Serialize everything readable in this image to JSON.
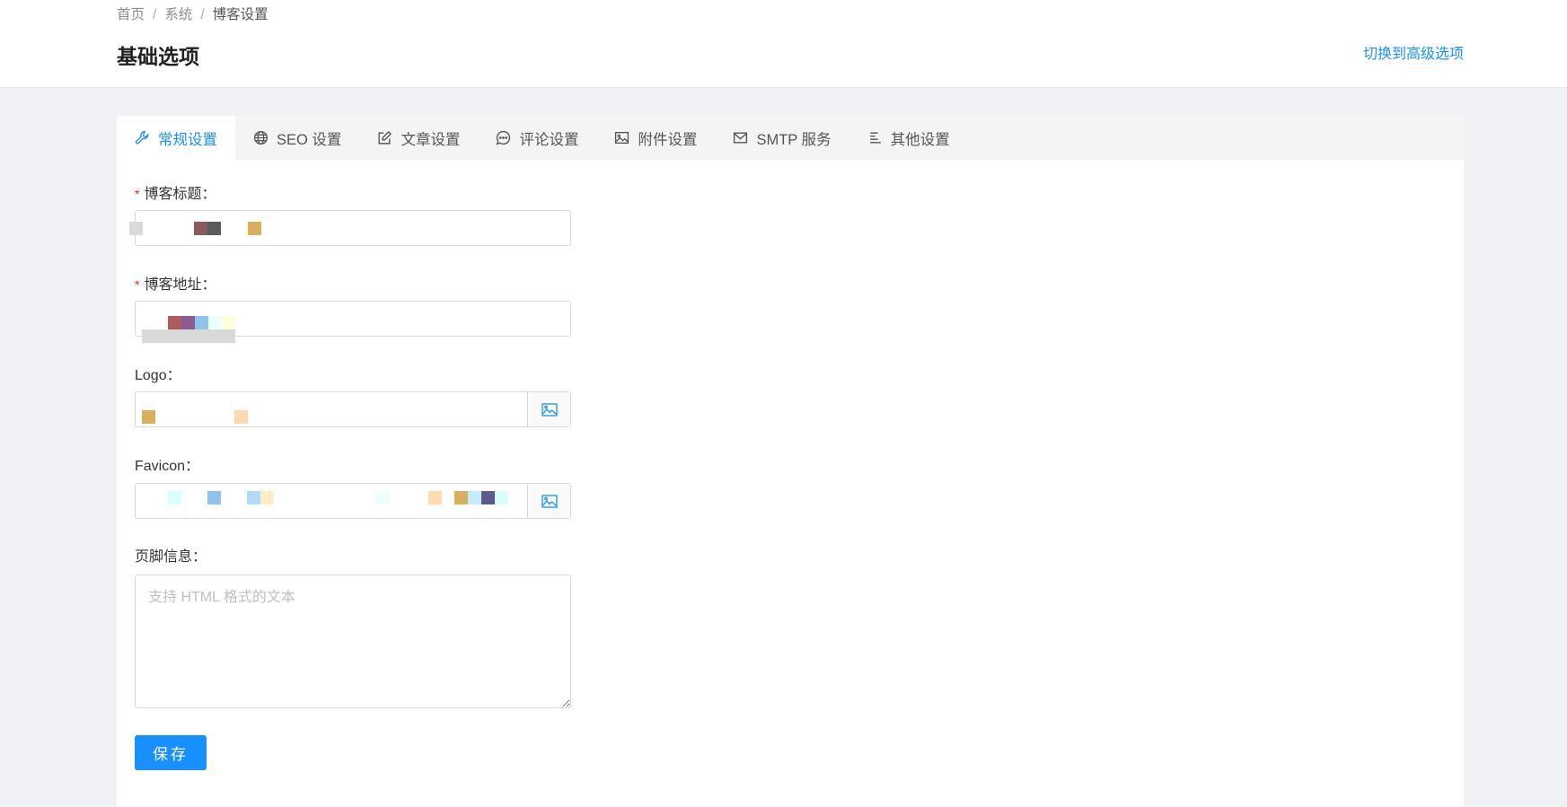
{
  "breadcrumb": [
    "首页",
    "系统",
    "博客设置"
  ],
  "breadcrumb_sep": "/",
  "page_title": "基础选项",
  "switch_link": "切换到高级选项",
  "tabs": [
    {
      "label": "常规设置",
      "icon": "wrench-icon",
      "active": true
    },
    {
      "label": "SEO 设置",
      "icon": "globe-icon"
    },
    {
      "label": "文章设置",
      "icon": "edit-icon"
    },
    {
      "label": "评论设置",
      "icon": "comment-icon"
    },
    {
      "label": "附件设置",
      "icon": "image-icon"
    },
    {
      "label": "SMTP 服务",
      "icon": "mail-icon"
    },
    {
      "label": "其他设置",
      "icon": "align-left-icon"
    }
  ],
  "form": {
    "title_label": "博客标题：",
    "url_label": "博客地址：",
    "logo_label": "Logo：",
    "favicon_label": "Favicon：",
    "footer_label": "页脚信息：",
    "footer_placeholder": "支持 HTML 格式的文本",
    "required_mark": "*",
    "save_label": "保存"
  },
  "colors": {
    "accent": "#1890ff",
    "required": "#f5222d"
  }
}
